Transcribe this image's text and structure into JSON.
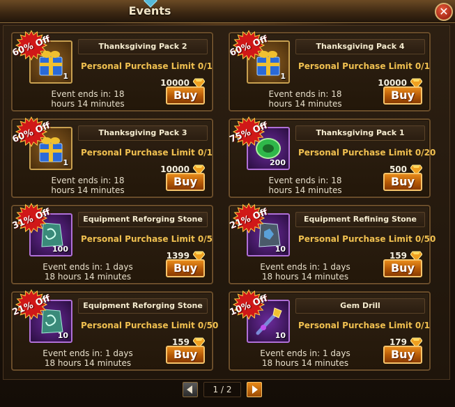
{
  "header": {
    "title": "Events"
  },
  "pager": {
    "label": "1 / 2"
  },
  "cards": [
    {
      "title": "Thanksgiving Pack 2",
      "discount": "60% Off",
      "limit": "Personal Purchase Limit 0/1",
      "price": "10000",
      "timer": "Event ends in: 18\nhours 14 minutes",
      "qty": "1",
      "item": "gift-box-icon",
      "frame": "gold",
      "buy": "Buy"
    },
    {
      "title": "Thanksgiving Pack 4",
      "discount": "60% Off",
      "limit": "Personal Purchase Limit 0/1",
      "price": "10000",
      "timer": "Event ends in: 18\nhours 14 minutes",
      "qty": "1",
      "item": "gift-box-icon",
      "frame": "gold",
      "buy": "Buy"
    },
    {
      "title": "Thanksgiving Pack 3",
      "discount": "60% Off",
      "limit": "Personal Purchase Limit 0/1",
      "price": "10000",
      "timer": "Event ends in: 18\nhours 14 minutes",
      "qty": "1",
      "item": "gift-box-icon",
      "frame": "gold",
      "buy": "Buy"
    },
    {
      "title": "Thanksgiving Pack 1",
      "discount": "75% Off",
      "limit": "Personal Purchase Limit 0/20",
      "price": "500",
      "timer": "Event ends in: 18\nhours 14 minutes",
      "qty": "200",
      "item": "green-coin-icon",
      "frame": "purple",
      "buy": "Buy"
    },
    {
      "title": "Equipment Reforging Stone",
      "discount": "31% Off",
      "limit": "Personal Purchase Limit 0/5",
      "price": "1399",
      "timer": "Event ends in: 1 days\n18 hours 14 minutes",
      "qty": "100",
      "item": "green-stone-icon",
      "frame": "purple",
      "buy": "Buy"
    },
    {
      "title": "Equipment Refining Stone",
      "discount": "21% Off",
      "limit": "Personal Purchase Limit 0/50",
      "price": "159",
      "timer": "Event ends in: 1 days\n18 hours 14 minutes",
      "qty": "10",
      "item": "blue-stone-icon",
      "frame": "purple",
      "buy": "Buy"
    },
    {
      "title": "Equipment Reforging Stone",
      "discount": "21% Off",
      "limit": "Personal Purchase Limit 0/50",
      "price": "159",
      "timer": "Event ends in: 1 days\n18 hours 14 minutes",
      "qty": "10",
      "item": "green-stone-icon",
      "frame": "purple",
      "buy": "Buy"
    },
    {
      "title": "Gem Drill",
      "discount": "10% Off",
      "limit": "Personal Purchase Limit 0/1",
      "price": "179",
      "timer": "Event ends in: 1 days\n18 hours 14 minutes",
      "qty": "10",
      "item": "gem-drill-icon",
      "frame": "purple",
      "buy": "Buy"
    }
  ],
  "colors": {
    "limit_text": "#f0c050",
    "buy_button": "#d8720e",
    "discount_burst": "#d01818"
  }
}
